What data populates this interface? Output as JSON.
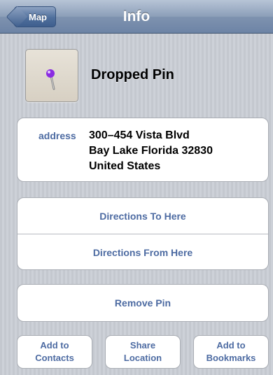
{
  "navbar": {
    "back_label": "Map",
    "title": "Info"
  },
  "pin": {
    "thumbnail_icon": "map-pin-icon",
    "pin_color": "#8a2be2",
    "title": "Dropped Pin"
  },
  "address": {
    "label": "address",
    "lines": [
      "300–454 Vista Blvd",
      "Bay Lake Florida 32830",
      "United States"
    ]
  },
  "directions": {
    "to_here": "Directions To Here",
    "from_here": "Directions From Here"
  },
  "remove": {
    "label": "Remove Pin"
  },
  "actions": [
    {
      "label": "Add to\nContacts"
    },
    {
      "label": "Share\nLocation"
    },
    {
      "label": "Add to\nBookmarks"
    }
  ],
  "colors": {
    "accent_text": "#4d6ba2",
    "navbar": "#7e92af"
  }
}
